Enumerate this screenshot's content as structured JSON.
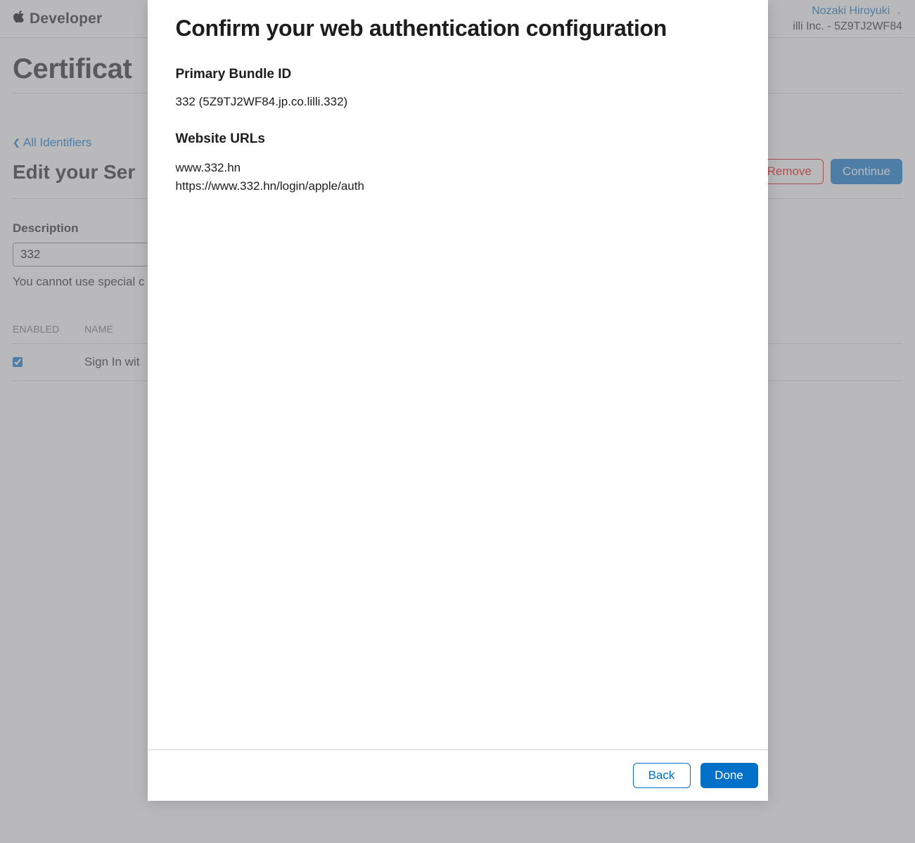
{
  "header": {
    "brand": "Developer",
    "user_name": "Nozaki Hiroyuki",
    "team_line": "illi Inc. - 5Z9TJ2WF84"
  },
  "page": {
    "mega_title": "Certificat",
    "breadcrumb": "All Identifiers",
    "edit_title": "Edit your Ser",
    "remove_btn": "Remove",
    "continue_btn": "Continue",
    "description_label": "Description",
    "description_value": "332",
    "description_hint": "You cannot use special c",
    "table": {
      "col_enabled": "ENABLED",
      "col_name": "NAME",
      "row0_name": "Sign In wit",
      "row0_checked": true
    }
  },
  "modal": {
    "title": "Confirm your web authentication configuration",
    "primary_bundle_id_h": "Primary Bundle ID",
    "primary_bundle_id_value": "332 (5Z9TJ2WF84.jp.co.lilli.332)",
    "website_urls_h": "Website URLs",
    "urls": [
      "www.332.hn",
      "https://www.332.hn/login/apple/auth"
    ],
    "back_btn": "Back",
    "done_btn": "Done"
  }
}
